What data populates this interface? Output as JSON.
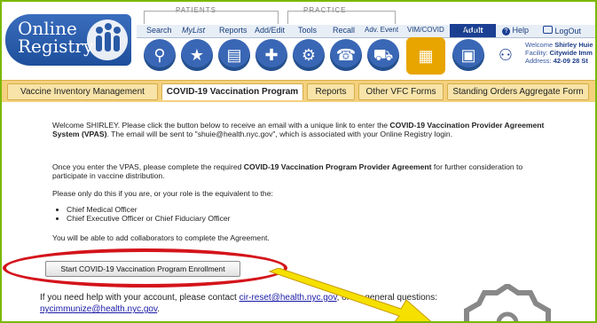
{
  "brand": {
    "logo_line1": "Online",
    "logo_line2": "Registry"
  },
  "header": {
    "groups": {
      "patients": "PATIENTS",
      "practice": "PRACTICE"
    },
    "nav": [
      "Search",
      "MyList",
      "Reports",
      "Add/Edit",
      "Tools",
      "Recall",
      "Adv. Event",
      "VIM/COVID",
      "Set Up"
    ],
    "mode_badge": "Adult",
    "help": "Help",
    "logout": "LogOut",
    "user": {
      "welcome_label": "Welcome",
      "welcome_name": "Shirley Huie",
      "facility_label": "Facility:",
      "facility_value": "Citywide Imm",
      "address_label": "Address:",
      "address_value": "42-09 28 St"
    }
  },
  "tabs": [
    {
      "label": "Vaccine Inventory Management",
      "active": false
    },
    {
      "label": "COVID-19 Vaccination Program",
      "active": true
    },
    {
      "label": "Reports",
      "active": false
    },
    {
      "label": "Other VFC Forms",
      "active": false
    },
    {
      "label": "Standing Orders Aggregate Form",
      "active": false
    }
  ],
  "content": {
    "para1_a": "Welcome SHIRLEY. Please click the button below to receive an email with a unique link to enter the ",
    "para1_b": "COVID-19 Vaccination Provider Agreement System (VPAS)",
    "para1_c": ". The email will be sent to \"shuie@health.nyc.gov\", which is associated with your Online Registry login.",
    "para2_a": "Once you enter the VPAS, please complete the required ",
    "para2_b": "COVID-19 Vaccination Program Provider Agreement",
    "para2_c": " for further consideration to participate in vaccine distribution.",
    "para3": "Please only do this if you are, or your role is the equivalent to the:",
    "roles": [
      "Chief Medical Officer",
      "Chief Executive Officer or Chief Fiduciary Officer"
    ],
    "para4": "You will be able to add collaborators to complete the Agreement.",
    "enroll_button": "Start COVID-19 Vaccination Program Enrollment",
    "help_prefix": "If you need help with your account, please contact ",
    "help_email1": "cir-reset@health.nyc.gov",
    "help_middle": ", or for general questions:",
    "help_email2": "nycimmunize@health.nyc.gov",
    "help_suffix": "."
  },
  "colors": {
    "frame": "#7ab800",
    "tabbar": "#f4d17e",
    "highlight": "#d4141b",
    "arrow": "#f5e000",
    "nav_blue": "#3a67b5"
  },
  "icons": [
    "search-icon",
    "mylist-icon",
    "reports-icon",
    "add-edit-icon",
    "tools-icon",
    "recall-icon",
    "adv-event-icon",
    "vim-covid-icon",
    "setup-icon",
    "adult-icon",
    "help-icon",
    "logout-icon"
  ]
}
